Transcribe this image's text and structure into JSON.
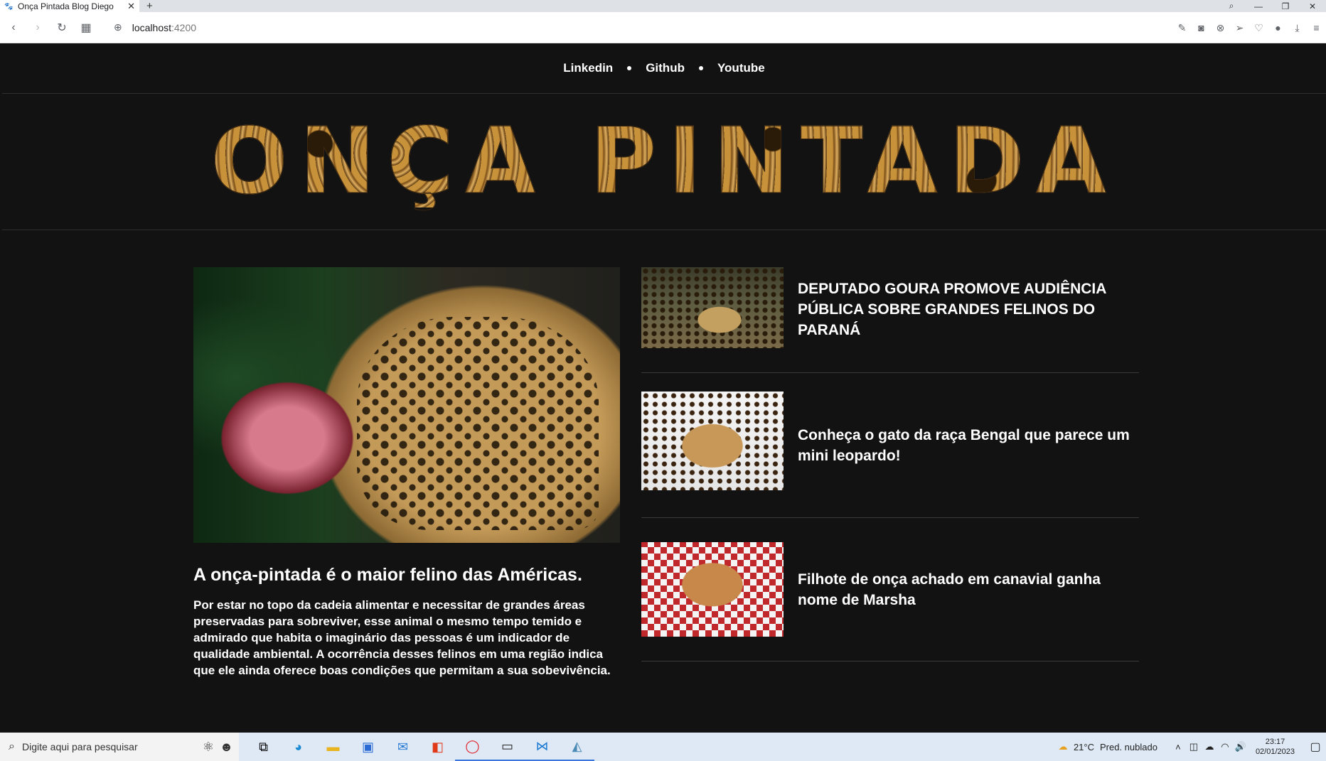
{
  "browser": {
    "tab_title": "Onça Pintada Blog Diego",
    "tab_close": "✕",
    "new_tab": "+",
    "url_host": "localhost",
    "url_port": ":4200",
    "window_controls": [
      "⌕",
      "—",
      "❐",
      "✕"
    ],
    "toolbar_icons": [
      "edit-icon",
      "camera-icon",
      "block-icon",
      "send-icon",
      "heart-icon",
      "profile-icon",
      "download-icon",
      "menu-icon"
    ]
  },
  "nav": {
    "links": [
      "Linkedin",
      "Github",
      "Youtube"
    ]
  },
  "hero": {
    "title": "ONÇA PINTADA"
  },
  "featured": {
    "title": "A onça-pintada é o maior felino das Américas.",
    "body": "Por estar no topo da cadeia alimentar e necessitar de grandes áreas preservadas para sobreviver, esse animal o mesmo tempo temido e admirado que habita o imaginário das pessoas é um indicador de qualidade ambiental. A ocorrência desses felinos em uma região indica que ele ainda oferece boas condições que permitam a sua sobevivência."
  },
  "articles": [
    {
      "title": "DEPUTADO GOURA PROMOVE AUDIÊNCIA PÚBLICA SOBRE GRANDES FELINOS DO PARANÁ"
    },
    {
      "title": "Conheça o gato da raça Bengal que parece um mini leopardo!"
    },
    {
      "title": "Filhote de onça achado em canavial ganha nome de Marsha"
    }
  ],
  "taskbar": {
    "search_placeholder": "Digite aqui para pesquisar",
    "weather_temp": "21°C",
    "weather_desc": "Pred. nublado",
    "time": "23:17",
    "date": "02/01/2023"
  }
}
